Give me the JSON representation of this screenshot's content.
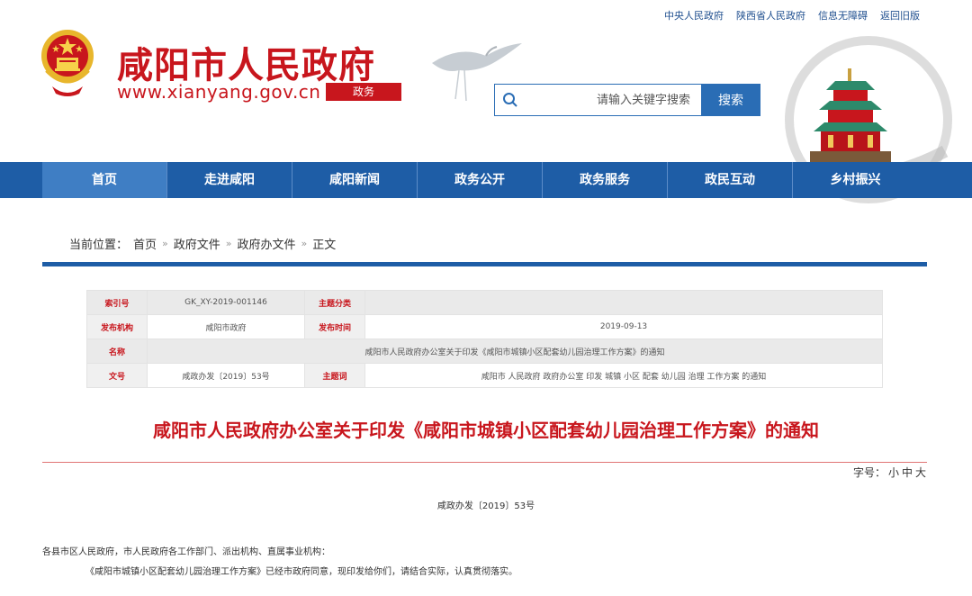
{
  "top_links": [
    "中央人民政府",
    "陕西省人民政府",
    "信息无障碍",
    "返回旧版"
  ],
  "header": {
    "site_name": "咸阳市人民政府",
    "url": "www.xianyang.gov.cn",
    "sub_label": "政务"
  },
  "search": {
    "placeholder": "请输入关键字搜索",
    "button_label": "搜索"
  },
  "nav": {
    "items": [
      "首页",
      "走进咸阳",
      "咸阳新闻",
      "政务公开",
      "政务服务",
      "政民互动",
      "乡村振兴"
    ],
    "active_index": 0
  },
  "breadcrumb": {
    "prefix": "当前位置：",
    "items": [
      "首页",
      "政府文件",
      "政府办文件",
      "正文"
    ],
    "separator": "»"
  },
  "meta": {
    "index_label": "索引号",
    "index_value": "GK_XY-2019-001146",
    "category_label": "主题分类",
    "category_value": "",
    "publisher_label": "发布机构",
    "publisher_value": "咸阳市政府",
    "date_label": "发布时间",
    "date_value": "2019-09-13",
    "name_label": "名称",
    "name_value": "咸阳市人民政府办公室关于印发《咸阳市城镇小区配套幼儿园治理工作方案》的通知",
    "docno_label": "文号",
    "docno_value": "咸政办发〔2019〕53号",
    "keywords_label": "主题词",
    "keywords_value": "咸阳市 人民政府 政府办公室 印发 城镇 小区 配套 幼儿园 治理 工作方案 的通知"
  },
  "article": {
    "title": "咸阳市人民政府办公室关于印发《咸阳市城镇小区配套幼儿园治理工作方案》的通知",
    "font_size_label": "字号：",
    "font_sizes": [
      "小",
      "中",
      "大"
    ],
    "doc_number": "咸政办发〔2019〕53号",
    "paragraph_1": "各县市区人民政府，市人民政府各工作部门、派出机构、直属事业机构：",
    "paragraph_2": "《咸阳市城镇小区配套幼儿园治理工作方案》已经市政府同意，现印发给你们，请结合实际，认真贯彻落实。"
  },
  "colors": {
    "brand_red": "#c8161d",
    "nav_blue": "#1e5da6",
    "nav_active": "#3f7ec4"
  },
  "icons": [
    "national-emblem-icon",
    "search-icon",
    "crane-icon",
    "tower-icon"
  ]
}
